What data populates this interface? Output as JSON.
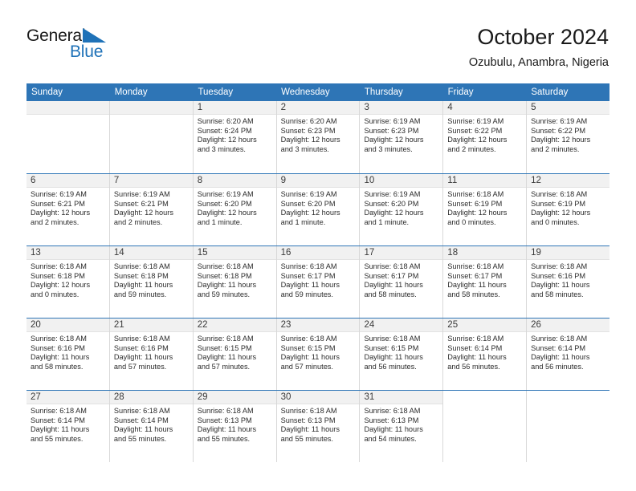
{
  "brand": {
    "name_top": "General",
    "name_bottom": "Blue",
    "accent_color": "#1f72b8",
    "triangle_icon": "triangle-icon"
  },
  "header": {
    "title": "October 2024",
    "subtitle": "Ozubulu, Anambra, Nigeria"
  },
  "colors": {
    "header_row_blue": "#2e75b6",
    "day_band_gray": "#f1f1f1",
    "grid_line": "#d8d8d8",
    "text": "#2b2b2b"
  },
  "calendar": {
    "weekday_headers": [
      "Sunday",
      "Monday",
      "Tuesday",
      "Wednesday",
      "Thursday",
      "Friday",
      "Saturday"
    ],
    "weeks": [
      [
        {
          "day": "",
          "empty": true,
          "sunrise": "",
          "sunset": "",
          "daylight_1": "",
          "daylight_2": ""
        },
        {
          "day": "",
          "empty": true,
          "sunrise": "",
          "sunset": "",
          "daylight_1": "",
          "daylight_2": ""
        },
        {
          "day": "1",
          "sunrise": "Sunrise: 6:20 AM",
          "sunset": "Sunset: 6:24 PM",
          "daylight_1": "Daylight: 12 hours",
          "daylight_2": "and 3 minutes."
        },
        {
          "day": "2",
          "sunrise": "Sunrise: 6:20 AM",
          "sunset": "Sunset: 6:23 PM",
          "daylight_1": "Daylight: 12 hours",
          "daylight_2": "and 3 minutes."
        },
        {
          "day": "3",
          "sunrise": "Sunrise: 6:19 AM",
          "sunset": "Sunset: 6:23 PM",
          "daylight_1": "Daylight: 12 hours",
          "daylight_2": "and 3 minutes."
        },
        {
          "day": "4",
          "sunrise": "Sunrise: 6:19 AM",
          "sunset": "Sunset: 6:22 PM",
          "daylight_1": "Daylight: 12 hours",
          "daylight_2": "and 2 minutes."
        },
        {
          "day": "5",
          "sunrise": "Sunrise: 6:19 AM",
          "sunset": "Sunset: 6:22 PM",
          "daylight_1": "Daylight: 12 hours",
          "daylight_2": "and 2 minutes."
        }
      ],
      [
        {
          "day": "6",
          "sunrise": "Sunrise: 6:19 AM",
          "sunset": "Sunset: 6:21 PM",
          "daylight_1": "Daylight: 12 hours",
          "daylight_2": "and 2 minutes."
        },
        {
          "day": "7",
          "sunrise": "Sunrise: 6:19 AM",
          "sunset": "Sunset: 6:21 PM",
          "daylight_1": "Daylight: 12 hours",
          "daylight_2": "and 2 minutes."
        },
        {
          "day": "8",
          "sunrise": "Sunrise: 6:19 AM",
          "sunset": "Sunset: 6:20 PM",
          "daylight_1": "Daylight: 12 hours",
          "daylight_2": "and 1 minute."
        },
        {
          "day": "9",
          "sunrise": "Sunrise: 6:19 AM",
          "sunset": "Sunset: 6:20 PM",
          "daylight_1": "Daylight: 12 hours",
          "daylight_2": "and 1 minute."
        },
        {
          "day": "10",
          "sunrise": "Sunrise: 6:19 AM",
          "sunset": "Sunset: 6:20 PM",
          "daylight_1": "Daylight: 12 hours",
          "daylight_2": "and 1 minute."
        },
        {
          "day": "11",
          "sunrise": "Sunrise: 6:18 AM",
          "sunset": "Sunset: 6:19 PM",
          "daylight_1": "Daylight: 12 hours",
          "daylight_2": "and 0 minutes."
        },
        {
          "day": "12",
          "sunrise": "Sunrise: 6:18 AM",
          "sunset": "Sunset: 6:19 PM",
          "daylight_1": "Daylight: 12 hours",
          "daylight_2": "and 0 minutes."
        }
      ],
      [
        {
          "day": "13",
          "sunrise": "Sunrise: 6:18 AM",
          "sunset": "Sunset: 6:18 PM",
          "daylight_1": "Daylight: 12 hours",
          "daylight_2": "and 0 minutes."
        },
        {
          "day": "14",
          "sunrise": "Sunrise: 6:18 AM",
          "sunset": "Sunset: 6:18 PM",
          "daylight_1": "Daylight: 11 hours",
          "daylight_2": "and 59 minutes."
        },
        {
          "day": "15",
          "sunrise": "Sunrise: 6:18 AM",
          "sunset": "Sunset: 6:18 PM",
          "daylight_1": "Daylight: 11 hours",
          "daylight_2": "and 59 minutes."
        },
        {
          "day": "16",
          "sunrise": "Sunrise: 6:18 AM",
          "sunset": "Sunset: 6:17 PM",
          "daylight_1": "Daylight: 11 hours",
          "daylight_2": "and 59 minutes."
        },
        {
          "day": "17",
          "sunrise": "Sunrise: 6:18 AM",
          "sunset": "Sunset: 6:17 PM",
          "daylight_1": "Daylight: 11 hours",
          "daylight_2": "and 58 minutes."
        },
        {
          "day": "18",
          "sunrise": "Sunrise: 6:18 AM",
          "sunset": "Sunset: 6:17 PM",
          "daylight_1": "Daylight: 11 hours",
          "daylight_2": "and 58 minutes."
        },
        {
          "day": "19",
          "sunrise": "Sunrise: 6:18 AM",
          "sunset": "Sunset: 6:16 PM",
          "daylight_1": "Daylight: 11 hours",
          "daylight_2": "and 58 minutes."
        }
      ],
      [
        {
          "day": "20",
          "sunrise": "Sunrise: 6:18 AM",
          "sunset": "Sunset: 6:16 PM",
          "daylight_1": "Daylight: 11 hours",
          "daylight_2": "and 58 minutes."
        },
        {
          "day": "21",
          "sunrise": "Sunrise: 6:18 AM",
          "sunset": "Sunset: 6:16 PM",
          "daylight_1": "Daylight: 11 hours",
          "daylight_2": "and 57 minutes."
        },
        {
          "day": "22",
          "sunrise": "Sunrise: 6:18 AM",
          "sunset": "Sunset: 6:15 PM",
          "daylight_1": "Daylight: 11 hours",
          "daylight_2": "and 57 minutes."
        },
        {
          "day": "23",
          "sunrise": "Sunrise: 6:18 AM",
          "sunset": "Sunset: 6:15 PM",
          "daylight_1": "Daylight: 11 hours",
          "daylight_2": "and 57 minutes."
        },
        {
          "day": "24",
          "sunrise": "Sunrise: 6:18 AM",
          "sunset": "Sunset: 6:15 PM",
          "daylight_1": "Daylight: 11 hours",
          "daylight_2": "and 56 minutes."
        },
        {
          "day": "25",
          "sunrise": "Sunrise: 6:18 AM",
          "sunset": "Sunset: 6:14 PM",
          "daylight_1": "Daylight: 11 hours",
          "daylight_2": "and 56 minutes."
        },
        {
          "day": "26",
          "sunrise": "Sunrise: 6:18 AM",
          "sunset": "Sunset: 6:14 PM",
          "daylight_1": "Daylight: 11 hours",
          "daylight_2": "and 56 minutes."
        }
      ],
      [
        {
          "day": "27",
          "sunrise": "Sunrise: 6:18 AM",
          "sunset": "Sunset: 6:14 PM",
          "daylight_1": "Daylight: 11 hours",
          "daylight_2": "and 55 minutes."
        },
        {
          "day": "28",
          "sunrise": "Sunrise: 6:18 AM",
          "sunset": "Sunset: 6:14 PM",
          "daylight_1": "Daylight: 11 hours",
          "daylight_2": "and 55 minutes."
        },
        {
          "day": "29",
          "sunrise": "Sunrise: 6:18 AM",
          "sunset": "Sunset: 6:13 PM",
          "daylight_1": "Daylight: 11 hours",
          "daylight_2": "and 55 minutes."
        },
        {
          "day": "30",
          "sunrise": "Sunrise: 6:18 AM",
          "sunset": "Sunset: 6:13 PM",
          "daylight_1": "Daylight: 11 hours",
          "daylight_2": "and 55 minutes."
        },
        {
          "day": "31",
          "sunrise": "Sunrise: 6:18 AM",
          "sunset": "Sunset: 6:13 PM",
          "daylight_1": "Daylight: 11 hours",
          "daylight_2": "and 54 minutes."
        },
        {
          "day": "",
          "empty": true,
          "hidden": true,
          "sunrise": "",
          "sunset": "",
          "daylight_1": "",
          "daylight_2": ""
        },
        {
          "day": "",
          "empty": true,
          "hidden": true,
          "sunrise": "",
          "sunset": "",
          "daylight_1": "",
          "daylight_2": ""
        }
      ]
    ]
  }
}
